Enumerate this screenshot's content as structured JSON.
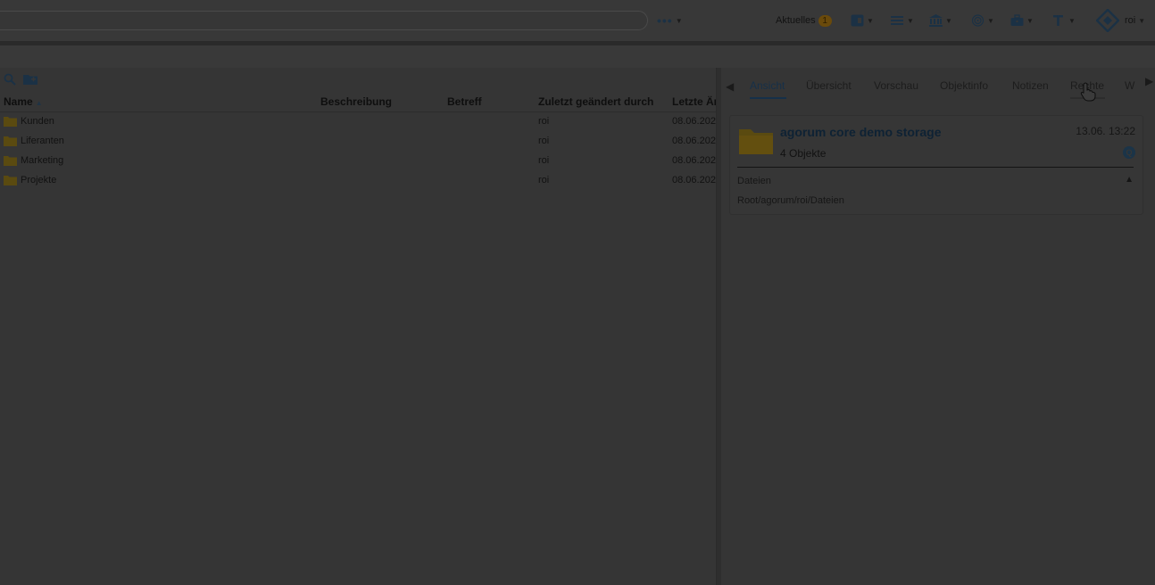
{
  "header": {
    "more_label": "•••",
    "aktuelles_label": "Aktuelles",
    "aktuelles_count": "1",
    "user_label": "roi",
    "icons": [
      "layout-icon",
      "list-icon",
      "bank-icon",
      "fingerprint-icon",
      "briefcase-icon",
      "text-icon",
      "agorum-logo-icon"
    ]
  },
  "columns": {
    "name": "Name",
    "beschreibung": "Beschreibung",
    "betreff": "Betreff",
    "zuletzt": "Zuletzt geändert durch",
    "letzte": "Letzte Är"
  },
  "rows": [
    {
      "name": "Kunden",
      "beschreibung": "",
      "betreff": "",
      "zuletzt": "roi",
      "letzte": "08.06.202"
    },
    {
      "name": "Liferanten",
      "beschreibung": "",
      "betreff": "",
      "zuletzt": "roi",
      "letzte": "08.06.202"
    },
    {
      "name": "Marketing",
      "beschreibung": "",
      "betreff": "",
      "zuletzt": "roi",
      "letzte": "08.06.202"
    },
    {
      "name": "Projekte",
      "beschreibung": "",
      "betreff": "",
      "zuletzt": "roi",
      "letzte": "08.06.202"
    }
  ],
  "tabs": [
    {
      "label": "Ansicht",
      "active": true
    },
    {
      "label": "Übersicht"
    },
    {
      "label": "Vorschau"
    },
    {
      "label": "Objektinfo"
    },
    {
      "label": "Notizen"
    },
    {
      "label": "Rechte"
    },
    {
      "label": "W"
    }
  ],
  "card": {
    "title": "agorum core demo storage",
    "subtitle": "4 Objekte",
    "date": "13.06. 13:22",
    "info_icon": "Q",
    "section_label": "Dateien",
    "path": "Root/agorum/roi/Dateien"
  },
  "colors": {
    "background": "#363636",
    "accent": "#163049",
    "folder": "#5a4a10",
    "badge": "#6a4a0b"
  }
}
